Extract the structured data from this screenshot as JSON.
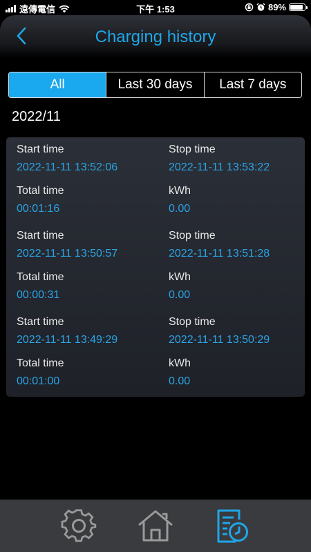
{
  "status_bar": {
    "carrier": "遠傳電信",
    "time": "下午 1:53",
    "battery": "89%",
    "battery_level": 0.89
  },
  "header": {
    "title": "Charging history"
  },
  "tabs": [
    {
      "label": "All",
      "active": true
    },
    {
      "label": "Last 30 days",
      "active": false
    },
    {
      "label": "Last 7 days",
      "active": false
    }
  ],
  "month": "2022/11",
  "labels": {
    "start": "Start time",
    "stop": "Stop time",
    "total": "Total time",
    "kwh": "kWh"
  },
  "records": [
    {
      "start": "2022-11-11 13:52:06",
      "stop": "2022-11-11 13:53:22",
      "total": "00:01:16",
      "kwh": "0.00"
    },
    {
      "start": "2022-11-11 13:50:57",
      "stop": "2022-11-11 13:51:28",
      "total": "00:00:31",
      "kwh": "0.00"
    },
    {
      "start": "2022-11-11 13:49:29",
      "stop": "2022-11-11 13:50:29",
      "total": "00:01:00",
      "kwh": "0.00"
    }
  ],
  "colors": {
    "accent": "#1aa8ee",
    "value_text": "#2aa4e6",
    "nav_bg": "#3a3b3e"
  },
  "bottom_nav": [
    {
      "icon": "gear-icon",
      "active": false
    },
    {
      "icon": "home-icon",
      "active": false
    },
    {
      "icon": "history-icon",
      "active": true
    }
  ]
}
